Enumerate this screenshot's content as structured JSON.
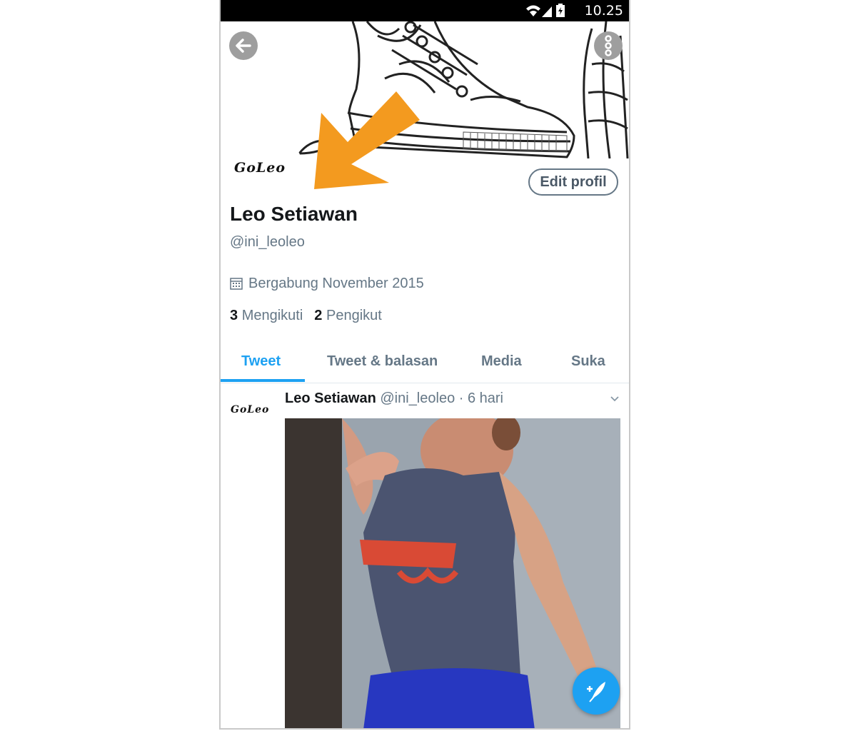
{
  "status_bar": {
    "time": "10.25"
  },
  "header": {
    "back_icon": "arrow-left-icon",
    "more_icon": "more-vertical-icon"
  },
  "profile": {
    "avatar_text": "GoLeo",
    "edit_label": "Edit profil",
    "name": "Leo Setiawan",
    "handle": "@ini_leoleo",
    "joined": "Bergabung November 2015",
    "following_count": "3",
    "following_label": "Mengikuti",
    "followers_count": "2",
    "followers_label": "Pengikut"
  },
  "tabs": [
    {
      "label": "Tweet",
      "active": true
    },
    {
      "label": "Tweet & balasan",
      "active": false
    },
    {
      "label": "Media",
      "active": false
    },
    {
      "label": "Suka",
      "active": false
    }
  ],
  "tweet": {
    "avatar_text": "GoLeo",
    "author": "Leo Setiawan",
    "meta": "@ini_leoleo · 6 hari"
  },
  "colors": {
    "accent": "#1da1f2",
    "annotation_arrow": "#f39a1f",
    "muted": "#657786"
  }
}
